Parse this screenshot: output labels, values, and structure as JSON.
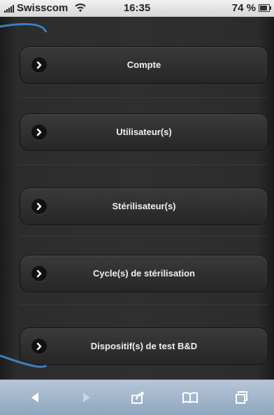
{
  "status_bar": {
    "carrier": "Swisscom",
    "time": "16:35",
    "battery": "74 %"
  },
  "menu": [
    {
      "label": "Compte"
    },
    {
      "label": "Utilisateur(s)"
    },
    {
      "label": "Stérilisateur(s)"
    },
    {
      "label": "Cycle(s) de stérilisation"
    },
    {
      "label": "Dispositif(s) de test B&D"
    }
  ],
  "colors": {
    "accent_curve": "#3d7fc4",
    "toolbar": "#9fb4cc"
  },
  "toolbar": {
    "icons": [
      "back-arrow-icon",
      "forward-arrow-icon",
      "share-icon",
      "bookmarks-icon",
      "tabs-icon"
    ]
  }
}
